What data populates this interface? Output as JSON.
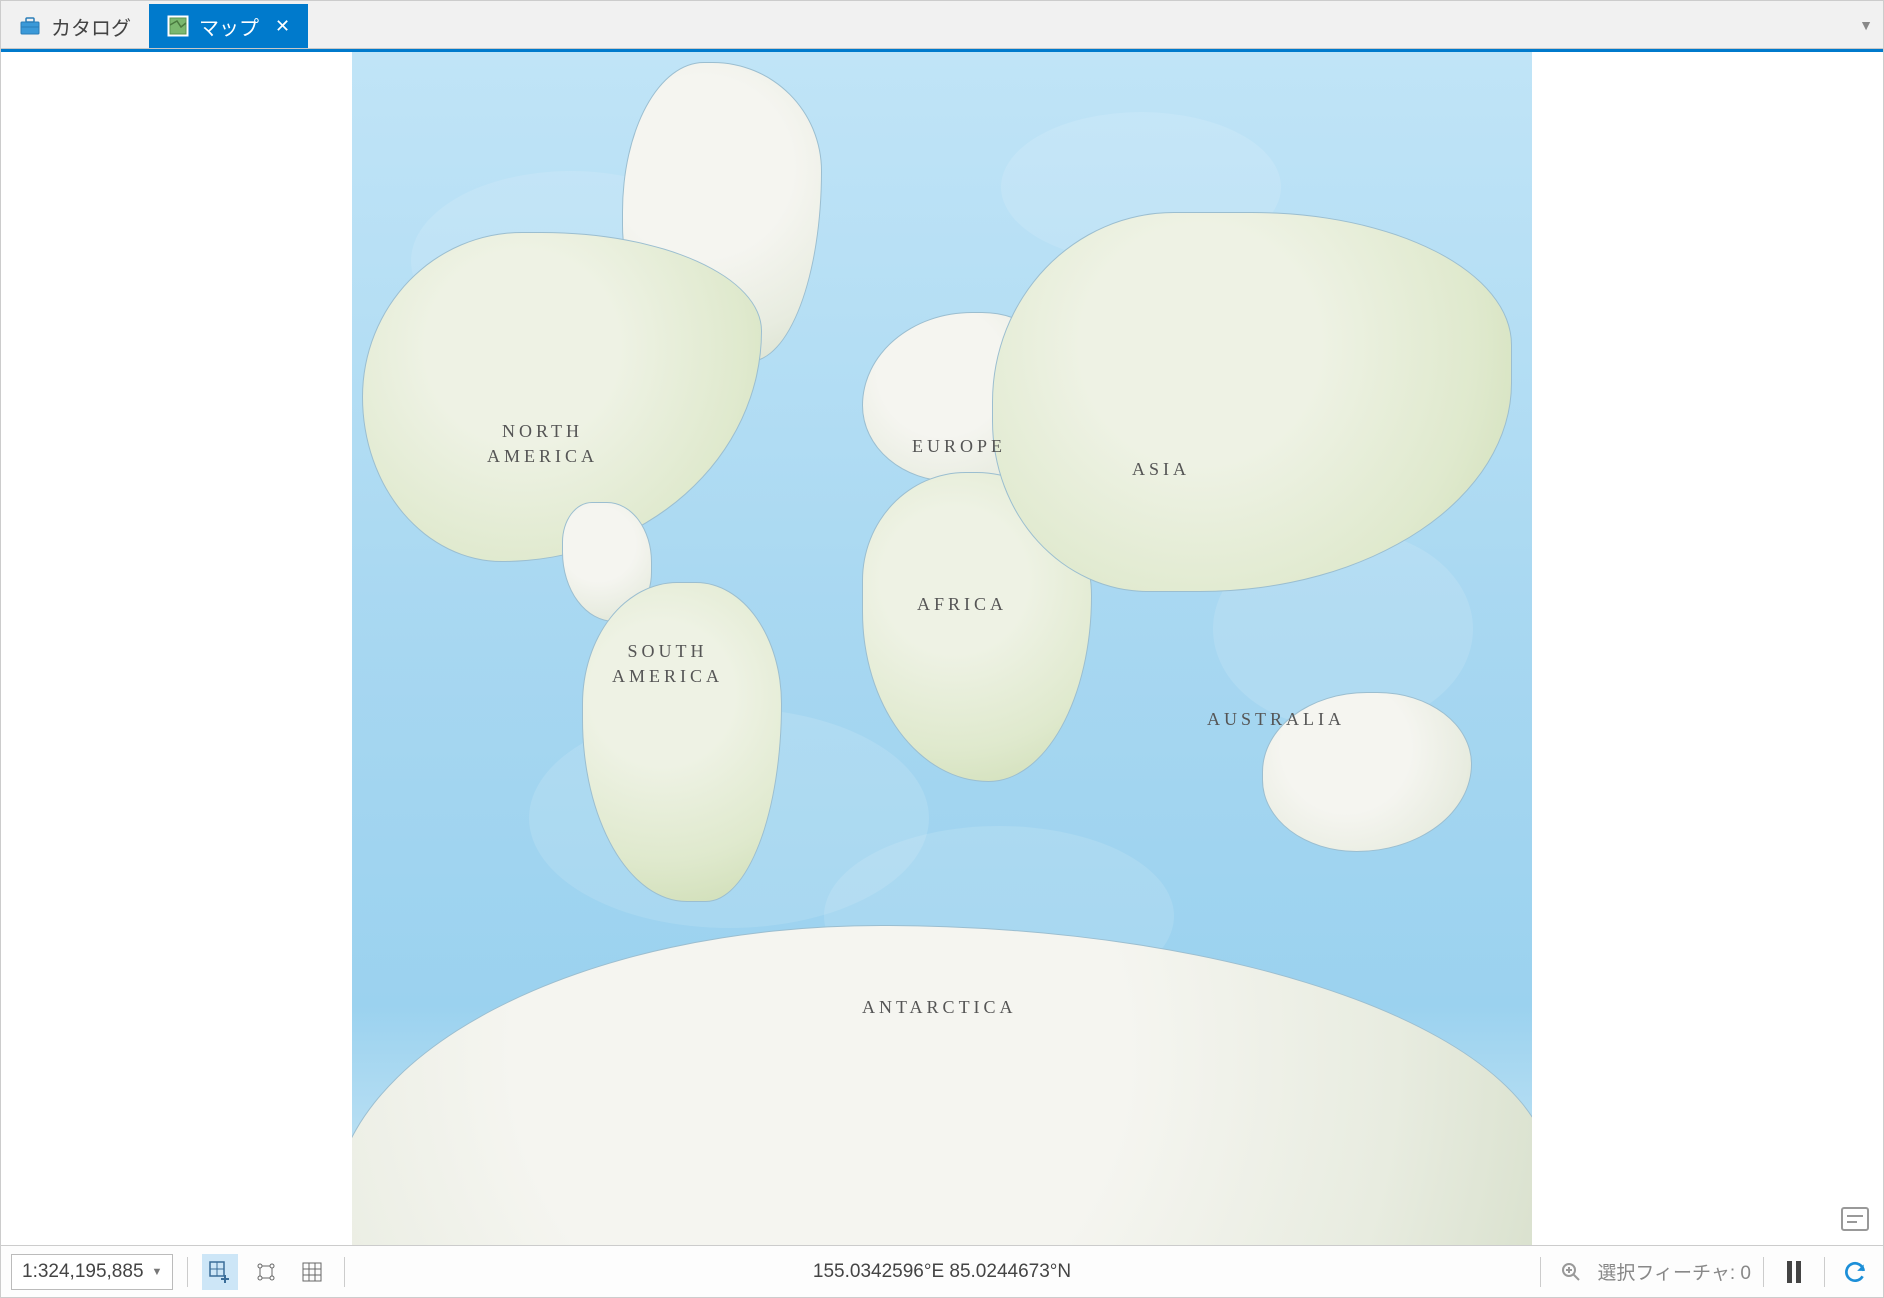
{
  "tabs": {
    "catalog": {
      "label": "カタログ"
    },
    "map": {
      "label": "マップ"
    }
  },
  "map": {
    "labels": {
      "north_america_l1": "NORTH",
      "north_america_l2": "AMERICA",
      "south_america_l1": "SOUTH",
      "south_america_l2": "AMERICA",
      "europe": "EUROPE",
      "africa": "AFRICA",
      "asia": "ASIA",
      "australia": "AUSTRALIA",
      "antarctica": "ANTARCTICA"
    }
  },
  "statusbar": {
    "scale": "1:324,195,885",
    "coordinates": "155.0342596°E 85.0244673°N",
    "selection_label": "選択フィーチャ:",
    "selection_count": "0"
  }
}
